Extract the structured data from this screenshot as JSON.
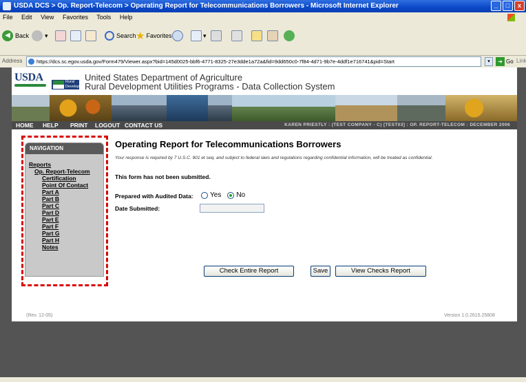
{
  "window": {
    "title": "USDA DCS > Op. Report-Telecom > Operating Report for Telecommunications Borrowers - Microsoft Internet Explorer",
    "controls": [
      "_",
      "□",
      "x"
    ]
  },
  "menu": [
    "File",
    "Edit",
    "View",
    "Favorites",
    "Tools",
    "Help"
  ],
  "toolbar": {
    "back": "Back",
    "search": "Search",
    "favorites": "Favorites"
  },
  "address": {
    "label": "Address",
    "url": "https://dcs.sc.egov.usda.gov/Form479/Viewer.aspx?bid=145d0025-bbf6-4771-8325-27e3dde1a72a&fid=9dd650c0-7f84-4d71-9b7e-4ddf1e716741&pid=Start",
    "go": "Go",
    "links": "Links"
  },
  "header": {
    "logo": "USDA",
    "rural_badge": "Rural Development",
    "dept_line1": "United States Department of Agriculture",
    "dept_line2": "Rural Development Utilities Programs - Data Collection System"
  },
  "navbar": {
    "items": [
      "HOME",
      "HELP",
      "PRINT",
      "LOGOUT",
      "CONTACT US"
    ],
    "user_info": "KAREN PRIESTLY : (TEST COMPANY - C) [TEST03] : OP. REPORT-TELECOM : DECEMBER 2006"
  },
  "navigation": {
    "heading": "NAVIGATION",
    "reports": "Reports",
    "report_name": "Op. Report-Telecom",
    "items": [
      "Certification",
      "Point Of Contact",
      "Part A",
      "Part B",
      "Part C",
      "Part D",
      "Part E",
      "Part F",
      "Part G",
      "Part H",
      "Notes"
    ]
  },
  "content": {
    "title": "Operating Report for Telecommunications Borrowers",
    "notice": "Your response is required by 7 U.S.C. 901 et seq. and subject to federal laws and regulations regarding confidential information, will be treated as confidential.",
    "status": "This form has not been submitted.",
    "audited_label": "Prepared with Audited Data:",
    "yes": "Yes",
    "no": "No",
    "selected": "No",
    "date_label": "Date Submitted:",
    "date_value": ""
  },
  "buttons": {
    "check": "Check Entire Report",
    "save": "Save",
    "view_checks": "View Checks Report"
  },
  "footer": {
    "rev": "(Rev. 12-05)",
    "version": "Version 1.0.2615.25808"
  },
  "colors": {
    "title_bar": "#0a48c8",
    "navbar": "#4a4a4a",
    "highlight_dash": "#d90000",
    "viewport_bg": "#545454"
  }
}
